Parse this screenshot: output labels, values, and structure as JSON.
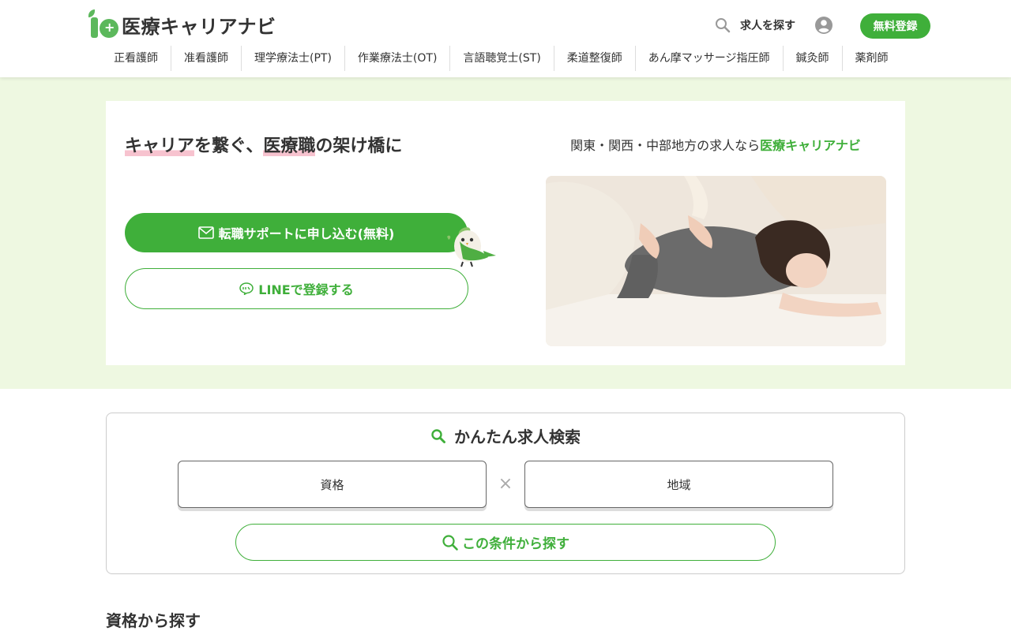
{
  "header": {
    "logo_text": "医療キャリアナビ",
    "search_label": "求人を探す",
    "register_label": "無料登録"
  },
  "nav": {
    "items": [
      {
        "label": "正看護師"
      },
      {
        "label": "准看護師"
      },
      {
        "label": "理学療法士(PT)"
      },
      {
        "label": "作業療法士(OT)"
      },
      {
        "label": "言語聴覚士(ST)"
      },
      {
        "label": "柔道整復師"
      },
      {
        "label": "あん摩マッサージ指圧師"
      },
      {
        "label": "鍼灸師"
      },
      {
        "label": "薬剤師"
      }
    ]
  },
  "hero": {
    "tagline_part1": "キャリア",
    "tagline_part2": "を繋ぐ、",
    "tagline_part3": "医療職",
    "tagline_part4": "の架け橋に",
    "subcopy_prefix": "関東・関西・中部地方の求人なら",
    "subcopy_brand": "医療キャリアナビ",
    "apply_button": "転職サポートに申し込む(無料)",
    "line_button": "LINEで登録する"
  },
  "search": {
    "title": "かんたん求人検索",
    "qualification_select": "資格",
    "area_select": "地域",
    "separator": "×",
    "submit_label": "この条件から探す"
  },
  "sections": {
    "by_qualification_title": "資格から探す"
  },
  "colors": {
    "brand_green": "#3faf3a",
    "hero_bg": "#eef8e1",
    "highlight_pink": "#f7c3cf"
  }
}
